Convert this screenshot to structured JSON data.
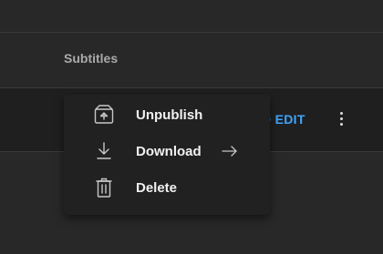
{
  "table": {
    "header_label": "Subtitles",
    "row_action_label": "D EDIT"
  },
  "menu": {
    "items": [
      {
        "label": "Unpublish",
        "icon": "unpublish-icon",
        "has_submenu": false
      },
      {
        "label": "Download",
        "icon": "download-icon",
        "has_submenu": true
      },
      {
        "label": "Delete",
        "icon": "trash-icon",
        "has_submenu": false
      }
    ]
  },
  "colors": {
    "background": "#282828",
    "row_background": "#1f1f1f",
    "menu_background": "#212121",
    "accent": "#3ea6ff",
    "text": "#f1f1f1",
    "muted_text": "#aaaaaa"
  }
}
